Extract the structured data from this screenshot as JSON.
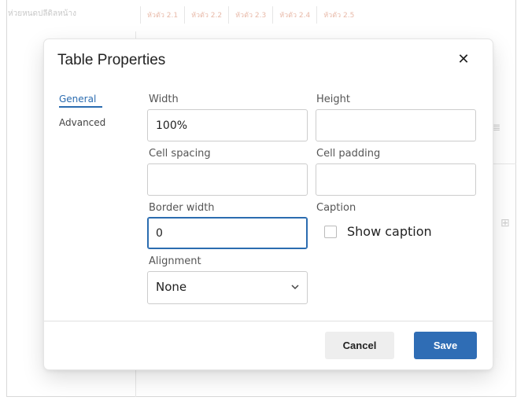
{
  "background": {
    "header_left": "ห่วยหนดปลีดิลหน้าง",
    "header_cells": [
      "หัวตัว 2.1",
      "หัวตัว 2.2",
      "หัวตัว 2.3",
      "หัวตัว 2.4",
      "หัวตัว 2.5"
    ]
  },
  "dialog": {
    "title": "Table Properties",
    "close_symbol": "✕",
    "nav": [
      {
        "label": "General",
        "active": true
      },
      {
        "label": "Advanced",
        "active": false
      }
    ],
    "fields": {
      "width": {
        "label": "Width",
        "value": "100%"
      },
      "height": {
        "label": "Height",
        "value": ""
      },
      "cell_spacing": {
        "label": "Cell spacing",
        "value": ""
      },
      "cell_padding": {
        "label": "Cell padding",
        "value": ""
      },
      "border_width": {
        "label": "Border width",
        "value": "0"
      },
      "caption": {
        "label": "Caption",
        "checkbox_label": "Show caption",
        "checked": false
      },
      "alignment": {
        "label": "Alignment",
        "value": "None"
      }
    },
    "buttons": {
      "cancel": "Cancel",
      "save": "Save"
    }
  },
  "colors": {
    "accent": "#2f6db5",
    "nav_active": "#2b6cb0"
  },
  "icons": {
    "close": "close-icon",
    "chevron": "chevron-down-icon"
  }
}
